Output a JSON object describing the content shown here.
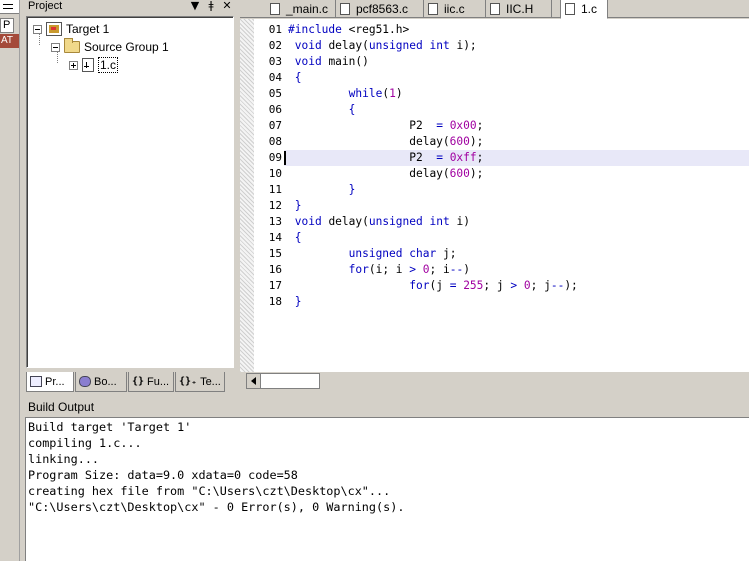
{
  "left_strip": {
    "item2": "P",
    "item3": "AT"
  },
  "project": {
    "title": "Project",
    "controls": [
      "▼",
      "📌",
      "✕"
    ],
    "tree": {
      "target": "Target 1",
      "group": "Source Group 1",
      "file": "1.c"
    },
    "tabs": [
      {
        "label": "Pr...",
        "icon": "project-icon"
      },
      {
        "label": "Bo...",
        "icon": "books-icon"
      },
      {
        "label": "Fu...",
        "icon": "functions-icon"
      },
      {
        "label": "Te...",
        "icon": "templates-icon"
      }
    ]
  },
  "editor_tabs": [
    {
      "label": "_main.c"
    },
    {
      "label": "pcf8563.c"
    },
    {
      "label": "iic.c"
    },
    {
      "label": "IIC.H"
    },
    {
      "label": "1.c",
      "active": true
    }
  ],
  "editor": {
    "line_numbers": [
      "01",
      "02",
      "03",
      "04",
      "05",
      "06",
      "07",
      "08",
      "09",
      "10",
      "11",
      "12",
      "13",
      "14",
      "15",
      "16",
      "17",
      "18"
    ],
    "current_line": 9
  },
  "build": {
    "title": "Build Output",
    "lines": [
      "Build target 'Target 1'",
      "compiling 1.c...",
      "linking...",
      "Program Size: data=9.0 xdata=0 code=58",
      "creating hex file from \"C:\\Users\\czt\\Desktop\\cx\"...",
      "\"C:\\Users\\czt\\Desktop\\cx\" - 0 Error(s), 0 Warning(s)."
    ]
  },
  "colors": {
    "keyword": "#0000c0",
    "number": "#a000a0",
    "current_line_bg": "#e8e8f8",
    "chrome": "#d4d0c8"
  }
}
